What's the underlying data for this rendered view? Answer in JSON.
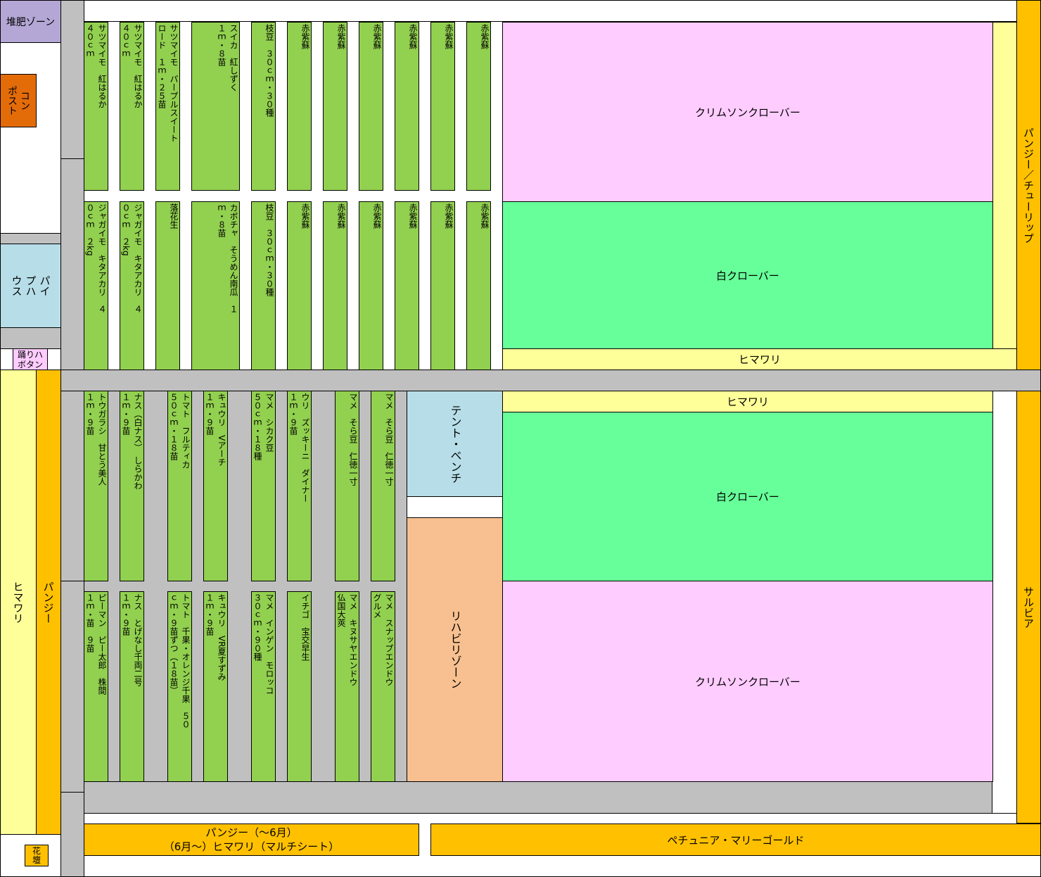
{
  "zones": {
    "compost_zone": "堆肥ゾーン",
    "compost": "コン\nポスト",
    "pipe_house": "パイ\nプハ\nウス",
    "odoriko": "踊りハ\nボタン",
    "himawari_left": "ヒマワリ",
    "pansy_left": "パンジー",
    "flowerbed": "花\n壇",
    "pansy_tulip": "パンジー／チューリップ",
    "salvia": "サルビア",
    "crimson_top": "クリムソンクローバー",
    "white_top": "白クローバー",
    "himawari_top": "ヒマワリ",
    "himawari_mid": "ヒマワリ",
    "white_bottom": "白クローバー",
    "crimson_bottom": "クリムソンクローバー",
    "tent_bench": "テント・ベンチ",
    "rehab_zone": "リハビリゾーン",
    "bottom_left": "パンジー（～6月）\n（6月～）ヒマワリ（マルチシート）",
    "bottom_right": "ペチュニア・マリーゴールド"
  },
  "beds": {
    "row1": [
      "サツマイモ　紅はるか\n４０ｃｍ",
      "サツマイモ　紅はるか\n４０ｃｍ",
      "サツマイモ　パープルスイート\nロード　１ｍ・２５苗",
      "スイカ　紅しずく\n１ｍ・８苗",
      "枝豆　３０ｃｍ・３０種",
      "赤紫蘇",
      "赤紫蘇",
      "赤紫蘇",
      "赤紫蘇",
      "赤紫蘇",
      "赤紫蘇"
    ],
    "row2": [
      "ジャガイモ　キタアカリ　４\n０ｃｍ　２kg",
      "ジャガイモ　キタアカリ　４\n０ｃｍ　２kg",
      "落花生",
      "カボチャ　そうめん南瓜　１\nｍ・８苗",
      "枝豆　３０ｃｍ・３０種",
      "赤紫蘇",
      "赤紫蘇",
      "赤紫蘇",
      "赤紫蘇",
      "赤紫蘇",
      "赤紫蘇"
    ],
    "row3": [
      "トウガラシ　甘とう美人\n１ｍ・９苗",
      "ナス（白ナス）　しらかわ\n１ｍ・９苗",
      "トマト　フルティカ\n５０ｃｍ・１８苗",
      "キュウリ　Vアーチ\n１ｍ・９苗",
      "マメ　シカク豆\n５０ｃｍ・１８種",
      "ウリ　ズッキーニ　ダイナー\n１ｍ・９苗",
      "マメ　そら豆　仁徳一寸",
      "マメ　そら豆　仁徳一寸"
    ],
    "row4": [
      "ピーマン　ピー太郎　株間\n１ｍ・苗　９苗",
      "ナス　とげなし千両二号\n１ｍ・９苗",
      "トマト　千果・オレンジ千果　５０\nｃｍ・９苗ずつ（１８苗）",
      "キュウリ　VR夏すずみ\n１ｍ・９苗",
      "マメ　インゲン　モロッコ\n３０ｃｍ・９０種",
      "イチゴ　宝交早生",
      "マメ　キヌサヤエンドウ\n仏国大莢",
      "マメ　スナップエンドウ\nグルメ"
    ]
  }
}
